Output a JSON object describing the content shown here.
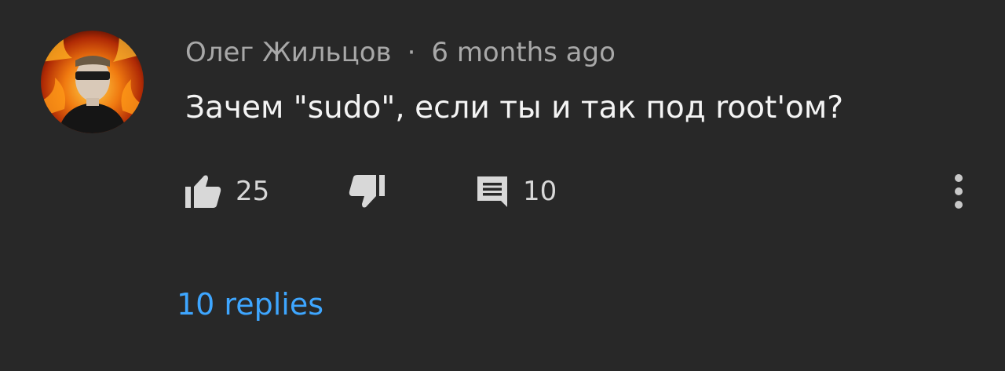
{
  "comment": {
    "author": "Олег Жильцов",
    "separator": "·",
    "timestamp": "6 months ago",
    "text": "Зачем \"sudo\", если ты и так под root'ом?"
  },
  "actions": {
    "like_count": "25",
    "reply_count": "10",
    "like_icon": "thumbs-up-icon",
    "dislike_icon": "thumbs-down-icon",
    "reply_icon": "comment-icon",
    "more_icon": "more-vertical-icon"
  },
  "replies_link": "10 replies",
  "colors": {
    "background": "#282828",
    "link": "#3ea6ff",
    "meta": "#a8a8a8",
    "text": "#f4f4f4"
  }
}
